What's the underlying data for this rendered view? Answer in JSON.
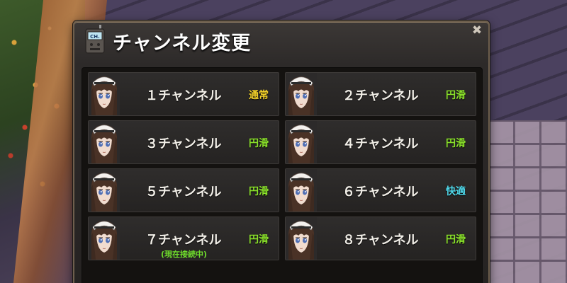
{
  "dialog": {
    "title": "チャンネル変更",
    "icon_label": "CH."
  },
  "colors": {
    "status_normal": "#f3d12a",
    "status_smooth": "#8be22b",
    "status_comfortable": "#4fd6e8",
    "current_note": "#6fdd2c"
  },
  "channels": [
    {
      "label": "１チャンネル",
      "status": "通常",
      "status_color": "#f3d12a"
    },
    {
      "label": "２チャンネル",
      "status": "円滑",
      "status_color": "#8be22b"
    },
    {
      "label": "３チャンネル",
      "status": "円滑",
      "status_color": "#8be22b"
    },
    {
      "label": "４チャンネル",
      "status": "円滑",
      "status_color": "#8be22b"
    },
    {
      "label": "５チャンネル",
      "status": "円滑",
      "status_color": "#8be22b"
    },
    {
      "label": "６チャンネル",
      "status": "快適",
      "status_color": "#4fd6e8"
    },
    {
      "label": "７チャンネル",
      "status": "円滑",
      "status_color": "#8be22b",
      "note": "(現在接続中)"
    },
    {
      "label": "８チャンネル",
      "status": "円滑",
      "status_color": "#8be22b"
    }
  ]
}
